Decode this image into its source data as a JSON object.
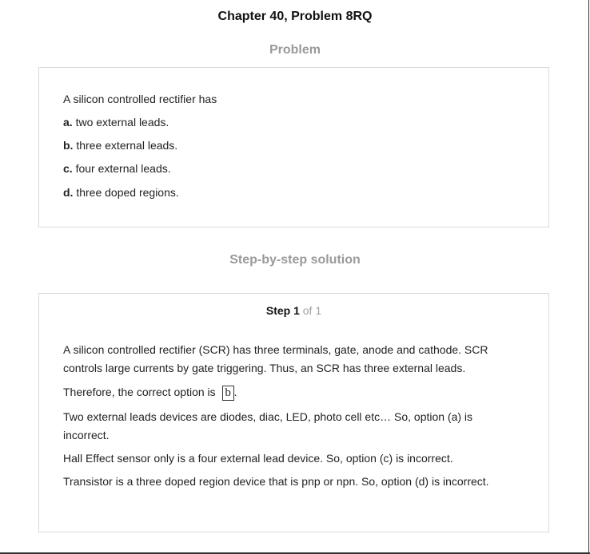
{
  "title": "Chapter 40, Problem 8RQ",
  "problem": {
    "heading": "Problem",
    "statement": "A silicon controlled rectifier has",
    "options": [
      {
        "letter": "a.",
        "text": " two external leads."
      },
      {
        "letter": "b.",
        "text": " three external leads."
      },
      {
        "letter": "c.",
        "text": " four external leads."
      },
      {
        "letter": "d.",
        "text": " three doped regions."
      }
    ]
  },
  "solution": {
    "heading": "Step-by-step solution",
    "step_word": "Step 1",
    "step_of": " of 1",
    "paragraph1": "A silicon controlled rectifier (SCR) has three terminals, gate, anode and cathode. SCR controls large currents by gate triggering. Thus, an SCR has three external leads.",
    "therefore_text": "Therefore, the correct option is",
    "answer": "b",
    "answer_suffix": ".",
    "paragraph2": "Two external leads devices are diodes, diac, LED, photo cell etc… So, option (a) is incorrect.",
    "paragraph3": "Hall Effect sensor only is a four external lead device. So, option (c) is incorrect.",
    "paragraph4": "Transistor is a three doped region device that is pnp or npn. So, option (d) is incorrect."
  }
}
